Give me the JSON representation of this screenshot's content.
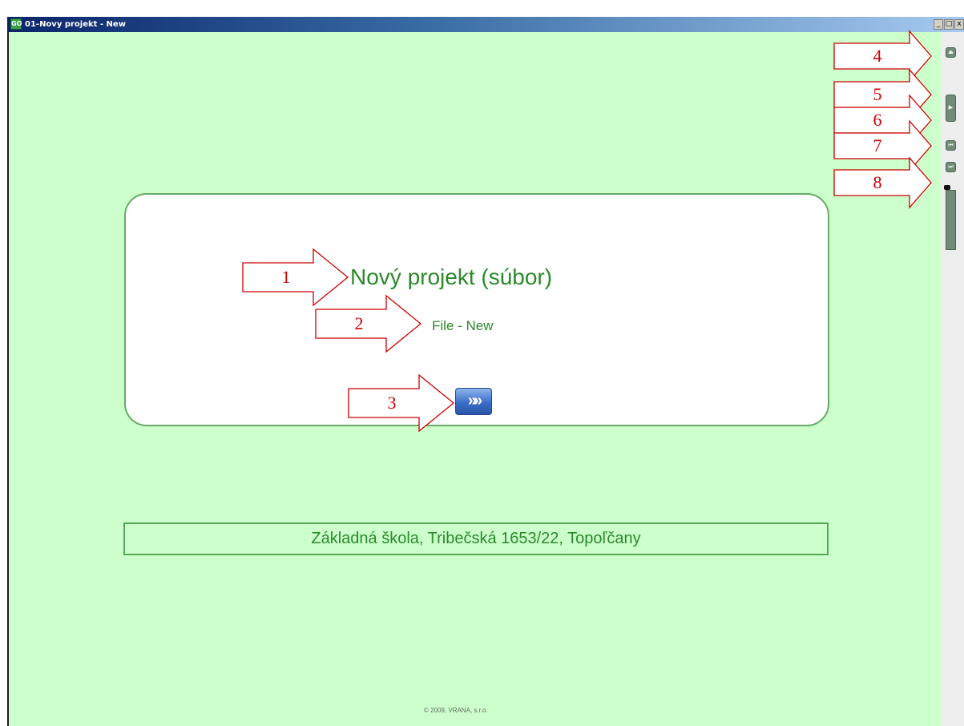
{
  "window": {
    "title": "01-Novy projekt - New",
    "app_icon_text": "GO",
    "minimize": "_",
    "maximize": "□",
    "close": "x"
  },
  "slide": {
    "title": "Nový projekt (súbor)",
    "subtitle": "File - New",
    "next_glyph": "»»"
  },
  "footer": {
    "school": "Základná škola, Tribečská 1653/22, Topoľčany",
    "copyright": "© 2009, VRANA, s.r.o."
  },
  "controls": {
    "exit_glyph": "⏏",
    "play_glyph": "▶",
    "rewind_glyph": "⏮",
    "forward_glyph": "⏭"
  },
  "callouts": [
    "1",
    "2",
    "3",
    "4",
    "5",
    "6",
    "7",
    "8"
  ],
  "colors": {
    "background": "#ccffcc",
    "text_green": "#2a8a2a",
    "callout_red": "#cc0000"
  }
}
